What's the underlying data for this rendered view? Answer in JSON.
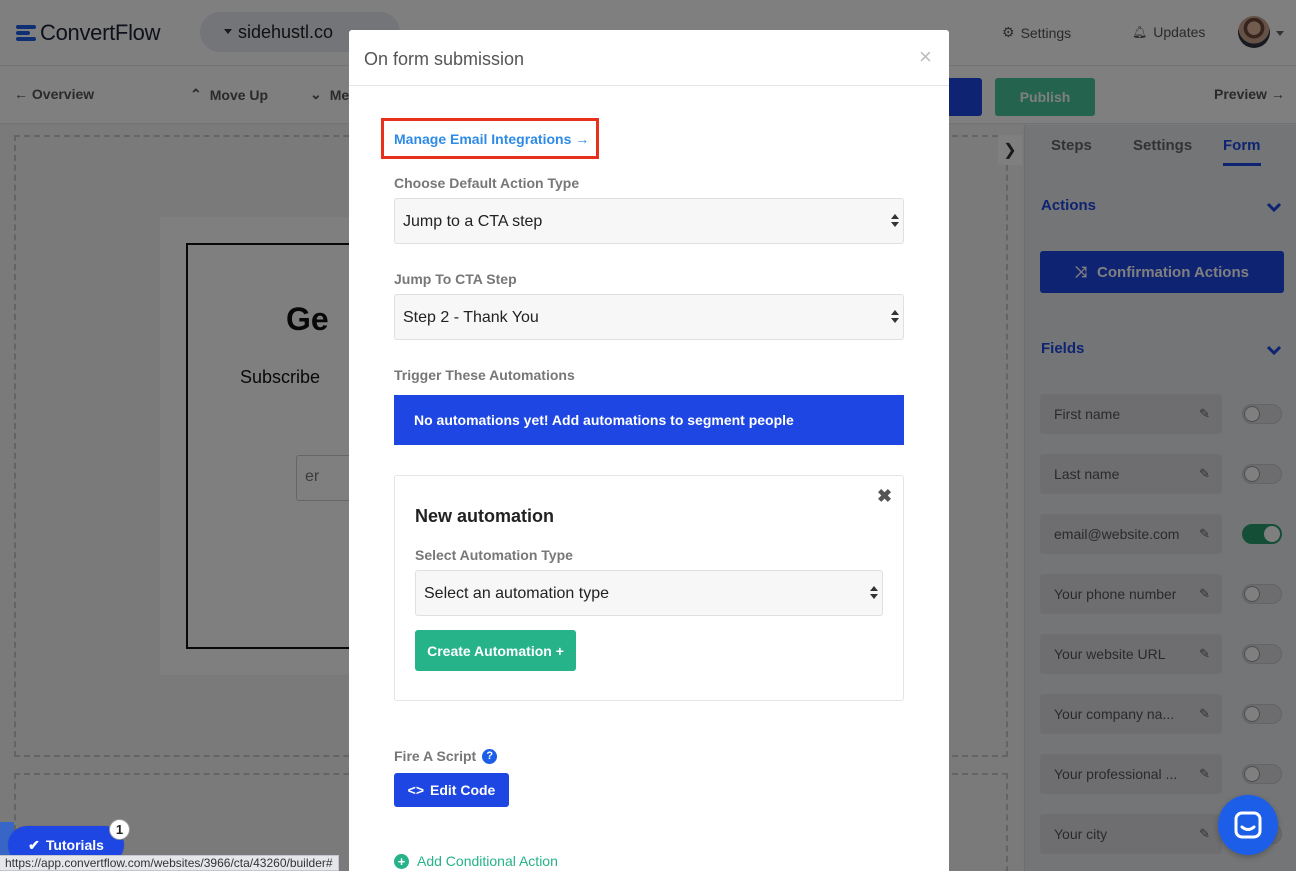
{
  "app": {
    "brand": "ConvertFlow",
    "site": "sidehustl.co",
    "nav": [
      "Settings",
      "Updates"
    ],
    "colors": {
      "primary": "#1d46e3",
      "link": "#2d8be6",
      "success": "#26b38a",
      "highlight": "#e8311d"
    }
  },
  "toolbar": {
    "overview": "← Overview",
    "move_up": "Move Up",
    "move_down": "Me",
    "publish": "Publish",
    "preview": "Preview →"
  },
  "canvas": {
    "heading": "Ge",
    "subheading": "Subscribe",
    "input_placeholder": "er"
  },
  "sidebar": {
    "tabs": [
      "Steps",
      "Settings",
      "Form"
    ],
    "active_tab": "Form",
    "actions_title": "Actions",
    "confirmation_button": "Confirmation Actions",
    "fields_title": "Fields",
    "fields": [
      {
        "label": "First name",
        "enabled": false
      },
      {
        "label": "Last name",
        "enabled": false
      },
      {
        "label": "email@website.com",
        "enabled": true
      },
      {
        "label": "Your phone number",
        "enabled": false
      },
      {
        "label": "Your website URL",
        "enabled": false
      },
      {
        "label": "Your company na...",
        "enabled": false
      },
      {
        "label": "Your professional ...",
        "enabled": false
      },
      {
        "label": "Your city",
        "enabled": false
      }
    ]
  },
  "modal": {
    "title": "On form submission",
    "close": "×",
    "manage_link": "Manage Email Integrations →",
    "default_action_label": "Choose Default Action Type",
    "default_action_value": "Jump to a CTA step",
    "jump_step_label": "Jump To CTA Step",
    "jump_step_value": "Step 2 - Thank You",
    "trigger_label": "Trigger These Automations",
    "no_automations": "No automations yet! Add automations to segment people",
    "new_automation": {
      "title": "New automation",
      "type_label": "Select Automation Type",
      "type_value": "Select an automation type",
      "create_button": "Create Automation +"
    },
    "fire_script_label": "Fire A Script",
    "edit_code": "Edit Code",
    "add_conditional": "Add Conditional Action"
  },
  "footer": {
    "tutorials": "Tutorials",
    "tutorials_badge": "1",
    "status_url": "https://app.convertflow.com/websites/3966/cta/43260/builder#"
  }
}
